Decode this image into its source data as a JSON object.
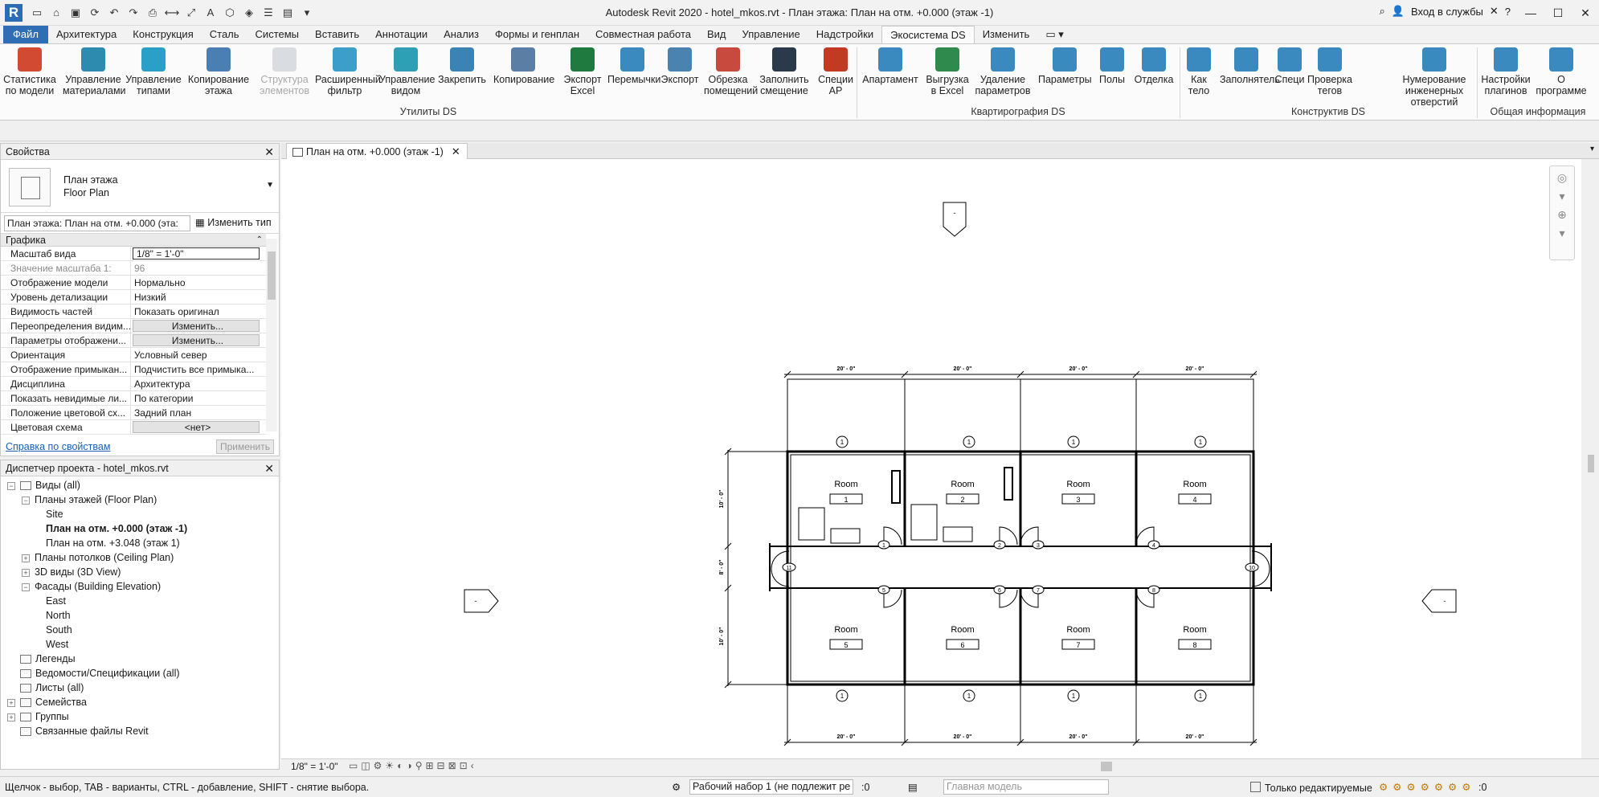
{
  "app": {
    "logo": "R",
    "title": "Autodesk Revit 2020 - hotel_mkos.rvt - План этажа: План на отм. +0.000 (этаж -1)",
    "signin": "Вход в службы",
    "help": "?"
  },
  "ribbon_tabs": [
    "Файл",
    "Архитектура",
    "Конструкция",
    "Сталь",
    "Системы",
    "Вставить",
    "Аннотации",
    "Анализ",
    "Формы и генплан",
    "Совместная работа",
    "Вид",
    "Управление",
    "Надстройки",
    "Экосистема DS",
    "Изменить"
  ],
  "ribbon_active_tab": "Экосистема DS",
  "ribbon_buttons": [
    {
      "l1": "Статистика",
      "l2": "по модели",
      "color": "#d24a32"
    },
    {
      "l1": "Управление",
      "l2": "материалами",
      "color": "#2e8bb0"
    },
    {
      "l1": "Управление",
      "l2": "типами",
      "color": "#2aa0c8"
    },
    {
      "l1": "Копирование",
      "l2": "этажа",
      "color": "#4a7fb4"
    },
    {
      "l1": "Структура",
      "l2": "элементов",
      "color": "#9aa6b4"
    },
    {
      "l1": "Расширенный",
      "l2": "фильтр",
      "color": "#3c9fc9"
    },
    {
      "l1": "Управление",
      "l2": "видом",
      "color": "#2f9fb6"
    },
    {
      "l1": "Закрепить",
      "l2": "",
      "color": "#3b82b5"
    },
    {
      "l1": "Копирование",
      "l2": "",
      "color": "#5a7ea6"
    },
    {
      "l1": "Экспорт",
      "l2": "Excel",
      "color": "#1e7a3e"
    },
    {
      "l1": "Перемычки",
      "l2": "",
      "color": "#3a8ac0"
    },
    {
      "l1": "Экспорт",
      "l2": "",
      "color": "#4a82b0"
    },
    {
      "l1": "Обрезка",
      "l2": "помещений",
      "color": "#c84a3e"
    },
    {
      "l1": "Заполнить",
      "l2": "смещение",
      "color": "#2b3a4a"
    },
    {
      "l1": "Специи",
      "l2": "АР",
      "color": "#c23a22"
    },
    {
      "l1": "Апартамент",
      "l2": "",
      "color": "#3a8ac0"
    },
    {
      "l1": "Выгрузка",
      "l2": "в Excel",
      "color": "#2f8a4e"
    },
    {
      "l1": "Удаление",
      "l2": "параметров",
      "color": "#3a8ac0"
    },
    {
      "l1": "Параметры",
      "l2": "",
      "color": "#3a8ac0"
    },
    {
      "l1": "Полы",
      "l2": "",
      "color": "#3a8ac0"
    },
    {
      "l1": "Отделка",
      "l2": "",
      "color": "#3a8ac0"
    },
    {
      "l1": "Как",
      "l2": "тело",
      "color": "#3a8ac0"
    },
    {
      "l1": "Заполнятель",
      "l2": "",
      "color": "#3a8ac0"
    },
    {
      "l1": "Специ",
      "l2": "",
      "color": "#3a8ac0"
    },
    {
      "l1": "Проверка",
      "l2": "тегов",
      "color": "#3a8ac0"
    },
    {
      "l1": "Нумерование",
      "l2": "инженерных отверстий",
      "color": "#3a8ac0"
    },
    {
      "l1": "Настройки",
      "l2": "плагинов",
      "color": "#3a8ac0"
    },
    {
      "l1": "О",
      "l2": "программе",
      "color": "#3a8ac0"
    }
  ],
  "ribbon_panels": [
    "Утилиты DS",
    "Квартирография DS",
    "Конструктив DS",
    "Общая информация"
  ],
  "properties": {
    "title": "Свойства",
    "type_name1": "План этажа",
    "type_name2": "Floor Plan",
    "instance_select": "План этажа: План на отм. +0.000 (эта:",
    "edit_type": "Изменить тип",
    "group": "Графика",
    "rows": [
      {
        "k": "Масштаб вида",
        "v": "1/8\" = 1'-0\""
      },
      {
        "k": "Значение масштаба    1:",
        "v": "96"
      },
      {
        "k": "Отображение модели",
        "v": "Нормально"
      },
      {
        "k": "Уровень детализации",
        "v": "Низкий"
      },
      {
        "k": "Видимость частей",
        "v": "Показать оригинал"
      },
      {
        "k": "Переопределения видим...",
        "v": "Изменить..."
      },
      {
        "k": "Параметры отображени...",
        "v": "Изменить..."
      },
      {
        "k": "Ориентация",
        "v": "Условный север"
      },
      {
        "k": "Отображение примыкан...",
        "v": "Подчистить все примыка..."
      },
      {
        "k": "Дисциплина",
        "v": "Архитектура"
      },
      {
        "k": "Показать невидимые ли...",
        "v": "По категории"
      },
      {
        "k": "Положение цветовой сх...",
        "v": "Задний план"
      },
      {
        "k": "Цветовая схема",
        "v": "<нет>"
      }
    ],
    "help_link": "Справка по свойствам",
    "apply": "Применить"
  },
  "browser": {
    "title": "Диспетчер проекта - hotel_mkos.rvt",
    "nodes": [
      {
        "t": "Виды (all)"
      },
      {
        "t": "Планы этажей (Floor Plan)"
      },
      {
        "t": "Site"
      },
      {
        "t": "План на отм. +0.000 (этаж -1)"
      },
      {
        "t": "План на отм. +3.048 (этаж 1)"
      },
      {
        "t": "Планы потолков (Ceiling Plan)"
      },
      {
        "t": "3D виды (3D View)"
      },
      {
        "t": "Фасады (Building Elevation)"
      },
      {
        "t": "East"
      },
      {
        "t": "North"
      },
      {
        "t": "South"
      },
      {
        "t": "West"
      },
      {
        "t": "Легенды"
      },
      {
        "t": "Ведомости/Спецификации (all)"
      },
      {
        "t": "Листы (all)"
      },
      {
        "t": "Семейства"
      },
      {
        "t": "Группы"
      },
      {
        "t": "Связанные файлы Revit"
      }
    ]
  },
  "view_tab": "План на отм. +0.000 (этаж -1)",
  "plan": {
    "rooms": [
      {
        "name": "Room",
        "num": "1"
      },
      {
        "name": "Room",
        "num": "2"
      },
      {
        "name": "Room",
        "num": "3"
      },
      {
        "name": "Room",
        "num": "4"
      },
      {
        "name": "Room",
        "num": "5"
      },
      {
        "name": "Room",
        "num": "6"
      },
      {
        "name": "Room",
        "num": "7"
      },
      {
        "name": "Room",
        "num": "8"
      }
    ],
    "dim_top": "20' - 0\"",
    "dim_side_top": "10' - 0\"",
    "dim_side_mid": "8' - 0\"",
    "dim_side_bot": "10' - 0\"",
    "window_tag": "1",
    "doors": [
      "1",
      "2",
      "3",
      "4",
      "5",
      "6",
      "7",
      "8"
    ],
    "corridor_left": "11",
    "corridor_right": "10",
    "elev_mark": "-"
  },
  "view_control": {
    "scale": "1/8\" = 1'-0\""
  },
  "status": {
    "message": "Щелчок - выбор, TAB - варианты, CTRL - добавление, SHIFT - снятие выбора.",
    "workset": "Рабочий набор 1 (не подлежит ре",
    "zero": ":0",
    "model": "Главная модель",
    "editable_only": "Только редактируемые",
    "filter": ":0"
  }
}
